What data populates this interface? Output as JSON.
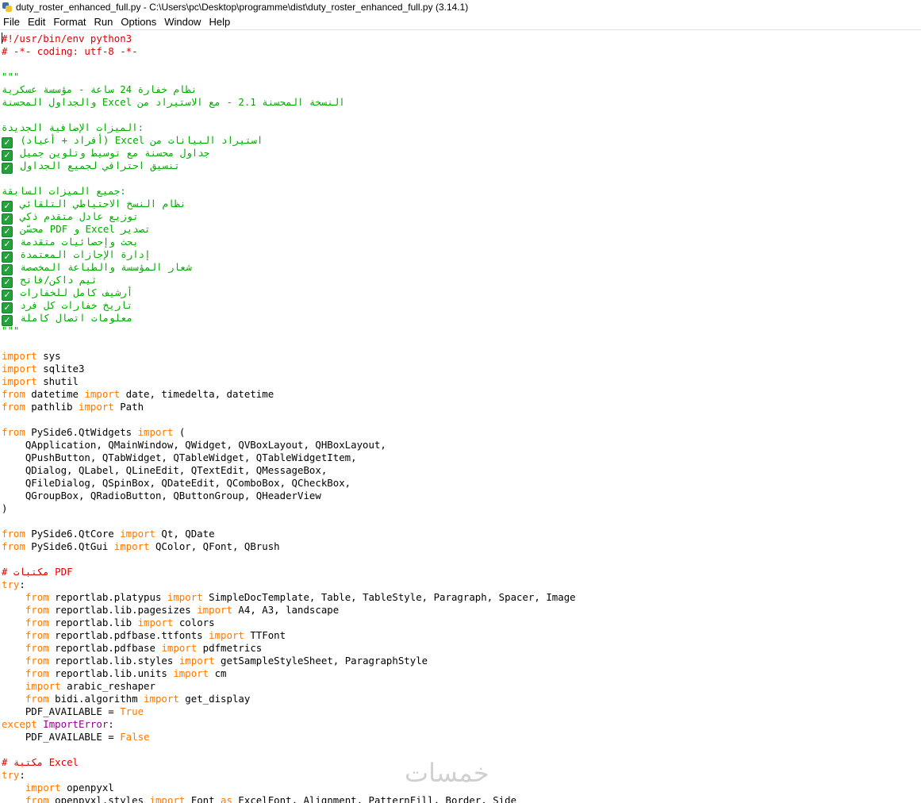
{
  "window": {
    "title": "duty_roster_enhanced_full.py - C:\\Users\\pc\\Desktop\\programme\\dist\\duty_roster_enhanced_full.py (3.14.1)"
  },
  "menu": [
    "File",
    "Edit",
    "Format",
    "Run",
    "Options",
    "Window",
    "Help"
  ],
  "icons": {
    "app": "python-idle-icon",
    "check": "check-mark-icon"
  },
  "colors": {
    "comment": "#dd0000",
    "string": "#00aa00",
    "keyword": "#ff7700",
    "builtin": "#900090",
    "check": "#22a33a"
  },
  "watermark": "خمسات",
  "code": [
    [
      [
        "c",
        "#!/usr/bin/env python3"
      ]
    ],
    [
      [
        "c",
        "# -*- coding: utf-8 -*-"
      ]
    ],
    [],
    [
      [
        "s",
        "\"\"\""
      ]
    ],
    [
      [
        "s",
        "نظام خفارة 24 ساعة - مؤسسة عسكرية"
      ]
    ],
    [
      [
        "s",
        "والجداول المحسنة Excel النسخة المحسنة 2.1 - مع الاستيراد من"
      ]
    ],
    [],
    [
      [
        "s",
        "الميزات الإضافية الجديدة:"
      ]
    ],
    [
      [
        "k",
        "✓"
      ],
      [
        "s",
        " (أفراد + أعياد) Excel استيراد البيانات من"
      ]
    ],
    [
      [
        "k",
        "✓"
      ],
      [
        "s",
        " جداول محسنة مع توسيط وتلوين جميل"
      ]
    ],
    [
      [
        "k",
        "✓"
      ],
      [
        "s",
        " تنسيق احترافي لجميع الجداول"
      ]
    ],
    [],
    [
      [
        "s",
        "جميع الميزات السابقة:"
      ]
    ],
    [
      [
        "k",
        "✓"
      ],
      [
        "s",
        " نظام النسخ الاحتياطي التلقائي"
      ]
    ],
    [
      [
        "k",
        "✓"
      ],
      [
        "s",
        " توزيع عادل متقدم ذكي"
      ]
    ],
    [
      [
        "k",
        "✓"
      ],
      [
        "s",
        " محسّن PDF و Excel تصدير"
      ]
    ],
    [
      [
        "k",
        "✓"
      ],
      [
        "s",
        " بحث وإحصائيات متقدمة"
      ]
    ],
    [
      [
        "k",
        "✓"
      ],
      [
        "s",
        " إدارة الإجازات المعتمدة"
      ]
    ],
    [
      [
        "k",
        "✓"
      ],
      [
        "s",
        " شعار المؤسسة والطباعة المخصصة"
      ]
    ],
    [
      [
        "k",
        "✓"
      ],
      [
        "s",
        " ثيم داكن/فاتح"
      ]
    ],
    [
      [
        "k",
        "✓"
      ],
      [
        "s",
        " أرشيف كامل للخفارات"
      ]
    ],
    [
      [
        "k",
        "✓"
      ],
      [
        "s",
        " تاريخ خفارات كل فرد"
      ]
    ],
    [
      [
        "k",
        "✓"
      ],
      [
        "s",
        " معلومات اتصال كاملة"
      ]
    ],
    [
      [
        "s",
        "\"\"\""
      ]
    ],
    [],
    [
      [
        "kw",
        "import"
      ],
      [
        "n",
        " sys"
      ]
    ],
    [
      [
        "kw",
        "import"
      ],
      [
        "n",
        " sqlite3"
      ]
    ],
    [
      [
        "kw",
        "import"
      ],
      [
        "n",
        " shutil"
      ]
    ],
    [
      [
        "kw",
        "from"
      ],
      [
        "n",
        " datetime "
      ],
      [
        "kw",
        "import"
      ],
      [
        "n",
        " date, timedelta, datetime"
      ]
    ],
    [
      [
        "kw",
        "from"
      ],
      [
        "n",
        " pathlib "
      ],
      [
        "kw",
        "import"
      ],
      [
        "n",
        " Path"
      ]
    ],
    [],
    [
      [
        "kw",
        "from"
      ],
      [
        "n",
        " PySide6.QtWidgets "
      ],
      [
        "kw",
        "import"
      ],
      [
        "n",
        " ("
      ]
    ],
    [
      [
        "n",
        "    QApplication, QMainWindow, QWidget, QVBoxLayout, QHBoxLayout,"
      ]
    ],
    [
      [
        "n",
        "    QPushButton, QTabWidget, QTableWidget, QTableWidgetItem,"
      ]
    ],
    [
      [
        "n",
        "    QDialog, QLabel, QLineEdit, QTextEdit, QMessageBox,"
      ]
    ],
    [
      [
        "n",
        "    QFileDialog, QSpinBox, QDateEdit, QComboBox, QCheckBox,"
      ]
    ],
    [
      [
        "n",
        "    QGroupBox, QRadioButton, QButtonGroup, QHeaderView"
      ]
    ],
    [
      [
        "n",
        ")"
      ]
    ],
    [],
    [
      [
        "kw",
        "from"
      ],
      [
        "n",
        " PySide6.QtCore "
      ],
      [
        "kw",
        "import"
      ],
      [
        "n",
        " Qt, QDate"
      ]
    ],
    [
      [
        "kw",
        "from"
      ],
      [
        "n",
        " PySide6.QtGui "
      ],
      [
        "kw",
        "import"
      ],
      [
        "n",
        " QColor, QFont, QBrush"
      ]
    ],
    [],
    [
      [
        "c",
        "# مكتبات PDF"
      ]
    ],
    [
      [
        "kw",
        "try"
      ],
      [
        "n",
        ":"
      ]
    ],
    [
      [
        "n",
        "    "
      ],
      [
        "kw",
        "from"
      ],
      [
        "n",
        " reportlab.platypus "
      ],
      [
        "kw",
        "import"
      ],
      [
        "n",
        " SimpleDocTemplate, Table, TableStyle, Paragraph, Spacer, Image"
      ]
    ],
    [
      [
        "n",
        "    "
      ],
      [
        "kw",
        "from"
      ],
      [
        "n",
        " reportlab.lib.pagesizes "
      ],
      [
        "kw",
        "import"
      ],
      [
        "n",
        " A4, A3, landscape"
      ]
    ],
    [
      [
        "n",
        "    "
      ],
      [
        "kw",
        "from"
      ],
      [
        "n",
        " reportlab.lib "
      ],
      [
        "kw",
        "import"
      ],
      [
        "n",
        " colors"
      ]
    ],
    [
      [
        "n",
        "    "
      ],
      [
        "kw",
        "from"
      ],
      [
        "n",
        " reportlab.pdfbase.ttfonts "
      ],
      [
        "kw",
        "import"
      ],
      [
        "n",
        " TTFont"
      ]
    ],
    [
      [
        "n",
        "    "
      ],
      [
        "kw",
        "from"
      ],
      [
        "n",
        " reportlab.pdfbase "
      ],
      [
        "kw",
        "import"
      ],
      [
        "n",
        " pdfmetrics"
      ]
    ],
    [
      [
        "n",
        "    "
      ],
      [
        "kw",
        "from"
      ],
      [
        "n",
        " reportlab.lib.styles "
      ],
      [
        "kw",
        "import"
      ],
      [
        "n",
        " getSampleStyleSheet, ParagraphStyle"
      ]
    ],
    [
      [
        "n",
        "    "
      ],
      [
        "kw",
        "from"
      ],
      [
        "n",
        " reportlab.lib.units "
      ],
      [
        "kw",
        "import"
      ],
      [
        "n",
        " cm"
      ]
    ],
    [
      [
        "n",
        "    "
      ],
      [
        "kw",
        "import"
      ],
      [
        "n",
        " arabic_reshaper"
      ]
    ],
    [
      [
        "n",
        "    "
      ],
      [
        "kw",
        "from"
      ],
      [
        "n",
        " bidi.algorithm "
      ],
      [
        "kw",
        "import"
      ],
      [
        "n",
        " get_display"
      ]
    ],
    [
      [
        "n",
        "    PDF_AVAILABLE = "
      ],
      [
        "kw",
        "True"
      ]
    ],
    [
      [
        "kw",
        "except"
      ],
      [
        "n",
        " "
      ],
      [
        "b",
        "ImportError"
      ],
      [
        "n",
        ":"
      ]
    ],
    [
      [
        "n",
        "    PDF_AVAILABLE = "
      ],
      [
        "kw",
        "False"
      ]
    ],
    [],
    [
      [
        "c",
        "# مكتبة Excel"
      ]
    ],
    [
      [
        "kw",
        "try"
      ],
      [
        "n",
        ":"
      ]
    ],
    [
      [
        "n",
        "    "
      ],
      [
        "kw",
        "import"
      ],
      [
        "n",
        " openpyxl"
      ]
    ],
    [
      [
        "n",
        "    "
      ],
      [
        "kw",
        "from"
      ],
      [
        "n",
        " openpyxl.styles "
      ],
      [
        "kw",
        "import"
      ],
      [
        "n",
        " Font "
      ],
      [
        "kw",
        "as"
      ],
      [
        "n",
        " ExcelFont, Alignment, PatternFill, Border, Side"
      ]
    ]
  ]
}
